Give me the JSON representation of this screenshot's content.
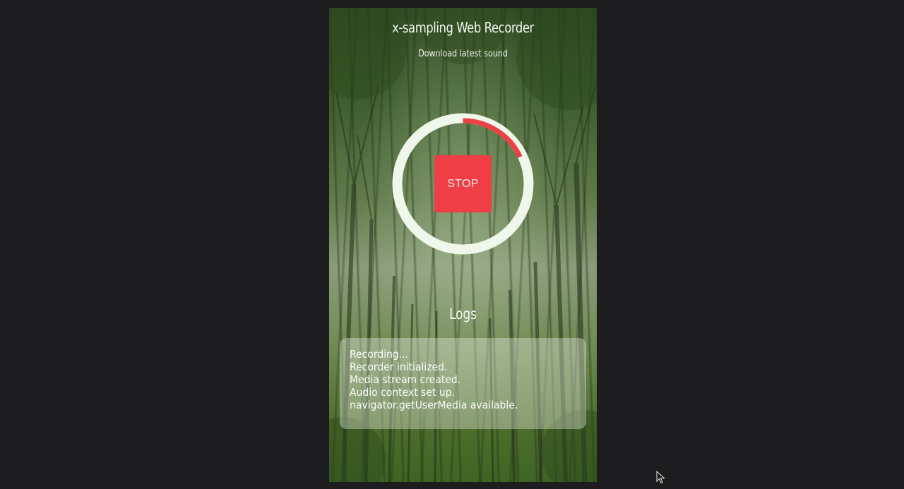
{
  "app": {
    "title": "x-sampling Web Recorder",
    "download_label": "Download latest sound"
  },
  "recorder": {
    "stop_label": "STOP",
    "progress": 0.18,
    "ring_color": "#eef7e9",
    "progress_color": "#ef3e45"
  },
  "logs": {
    "heading": "Logs",
    "lines": [
      "Recording...",
      "Recorder initialized.",
      "Media stream created.",
      "Audio context set up.",
      "navigator.getUserMedia available."
    ]
  },
  "icons": {
    "cursor": "mouse-pointer-icon"
  }
}
